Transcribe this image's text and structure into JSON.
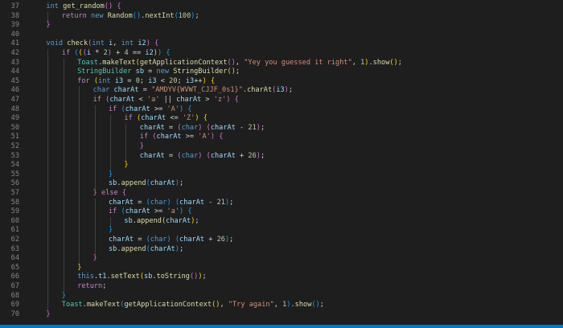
{
  "colors": {
    "background": "#1e1e1e",
    "line_number": "#858585",
    "keyword_control": "#c586c0",
    "keyword": "#569cd6",
    "type": "#4ec9b0",
    "function": "#dcdcaa",
    "variable": "#9cdcfe",
    "number": "#b5cea8",
    "string": "#ce9178",
    "plain": "#d4d4d4",
    "bracket_1": "#ffd700",
    "bracket_2": "#da70d6",
    "bracket_3": "#179fff",
    "status_bar": "#007acc"
  },
  "lines": [
    {
      "num": "37",
      "indent": 1,
      "tokens": [
        [
          "int",
          "keyword"
        ],
        [
          " ",
          "plain"
        ],
        [
          "get_random",
          "function"
        ],
        [
          "()",
          "bracket_2"
        ],
        [
          " ",
          "plain"
        ],
        [
          "{",
          "bracket_2"
        ]
      ]
    },
    {
      "num": "38",
      "indent": 2,
      "tokens": [
        [
          "return",
          "keyword_control"
        ],
        [
          " ",
          "plain"
        ],
        [
          "new",
          "keyword"
        ],
        [
          " ",
          "plain"
        ],
        [
          "Random",
          "function"
        ],
        [
          "()",
          "bracket_3"
        ],
        [
          ".",
          "plain"
        ],
        [
          "nextInt",
          "function"
        ],
        [
          "(",
          "bracket_3"
        ],
        [
          "100",
          "number"
        ],
        [
          ")",
          "bracket_3"
        ],
        [
          ";",
          "plain"
        ]
      ]
    },
    {
      "num": "39",
      "indent": 1,
      "tokens": [
        [
          "}",
          "bracket_2"
        ]
      ]
    },
    {
      "num": "40",
      "indent": 0,
      "tokens": []
    },
    {
      "num": "41",
      "indent": 1,
      "tokens": [
        [
          "void",
          "keyword"
        ],
        [
          " ",
          "plain"
        ],
        [
          "check",
          "function"
        ],
        [
          "(",
          "bracket_2"
        ],
        [
          "int",
          "keyword"
        ],
        [
          " ",
          "plain"
        ],
        [
          "i",
          "variable"
        ],
        [
          ", ",
          "plain"
        ],
        [
          "int",
          "keyword"
        ],
        [
          " ",
          "plain"
        ],
        [
          "i2",
          "variable"
        ],
        [
          ")",
          "bracket_2"
        ],
        [
          " ",
          "plain"
        ],
        [
          "{",
          "bracket_2"
        ]
      ]
    },
    {
      "num": "42",
      "indent": 2,
      "tokens": [
        [
          "if",
          "keyword_control"
        ],
        [
          " ",
          "plain"
        ],
        [
          "(",
          "bracket_3"
        ],
        [
          "(",
          "bracket_1"
        ],
        [
          "(",
          "bracket_2"
        ],
        [
          "i",
          "variable"
        ],
        [
          " * ",
          "plain"
        ],
        [
          "2",
          "number"
        ],
        [
          ")",
          "bracket_2"
        ],
        [
          " + ",
          "plain"
        ],
        [
          "4",
          "number"
        ],
        [
          " == ",
          "plain"
        ],
        [
          "i2",
          "variable"
        ],
        [
          ")",
          "bracket_1"
        ],
        [
          ")",
          "bracket_3"
        ],
        [
          " ",
          "plain"
        ],
        [
          "{",
          "bracket_3"
        ]
      ]
    },
    {
      "num": "43",
      "indent": 3,
      "tokens": [
        [
          "Toast",
          "type"
        ],
        [
          ".",
          "plain"
        ],
        [
          "makeText",
          "function"
        ],
        [
          "(",
          "bracket_1"
        ],
        [
          "getApplicationContext",
          "function"
        ],
        [
          "()",
          "bracket_2"
        ],
        [
          ", ",
          "plain"
        ],
        [
          "\"Yey you guessed it right\"",
          "string"
        ],
        [
          ", ",
          "plain"
        ],
        [
          "1",
          "number"
        ],
        [
          ")",
          "bracket_1"
        ],
        [
          ".",
          "plain"
        ],
        [
          "show",
          "function"
        ],
        [
          "()",
          "bracket_1"
        ],
        [
          ";",
          "plain"
        ]
      ]
    },
    {
      "num": "44",
      "indent": 3,
      "tokens": [
        [
          "StringBuilder",
          "type"
        ],
        [
          " ",
          "plain"
        ],
        [
          "sb",
          "variable"
        ],
        [
          " = ",
          "plain"
        ],
        [
          "new",
          "keyword"
        ],
        [
          " ",
          "plain"
        ],
        [
          "StringBuilder",
          "function"
        ],
        [
          "()",
          "bracket_1"
        ],
        [
          ";",
          "plain"
        ]
      ]
    },
    {
      "num": "45",
      "indent": 3,
      "tokens": [
        [
          "for",
          "keyword_control"
        ],
        [
          " ",
          "plain"
        ],
        [
          "(",
          "bracket_1"
        ],
        [
          "int",
          "keyword"
        ],
        [
          " ",
          "plain"
        ],
        [
          "i3",
          "variable"
        ],
        [
          " = ",
          "plain"
        ],
        [
          "0",
          "number"
        ],
        [
          "; ",
          "plain"
        ],
        [
          "i3",
          "variable"
        ],
        [
          " < ",
          "plain"
        ],
        [
          "20",
          "number"
        ],
        [
          "; ",
          "plain"
        ],
        [
          "i3",
          "variable"
        ],
        [
          "++",
          "plain"
        ],
        [
          ")",
          "bracket_1"
        ],
        [
          " ",
          "plain"
        ],
        [
          "{",
          "bracket_1"
        ]
      ]
    },
    {
      "num": "46",
      "indent": 4,
      "tokens": [
        [
          "char",
          "keyword"
        ],
        [
          " ",
          "plain"
        ],
        [
          "charAt",
          "variable"
        ],
        [
          " = ",
          "plain"
        ],
        [
          "\"AMDYV{WVWT_CJJF_0s1}\"",
          "string"
        ],
        [
          ".",
          "plain"
        ],
        [
          "charAt",
          "function"
        ],
        [
          "(",
          "bracket_2"
        ],
        [
          "i3",
          "variable"
        ],
        [
          ")",
          "bracket_2"
        ],
        [
          ";",
          "plain"
        ]
      ]
    },
    {
      "num": "47",
      "indent": 4,
      "tokens": [
        [
          "if",
          "keyword_control"
        ],
        [
          " ",
          "plain"
        ],
        [
          "(",
          "bracket_2"
        ],
        [
          "charAt",
          "variable"
        ],
        [
          " < ",
          "plain"
        ],
        [
          "'a'",
          "string"
        ],
        [
          " || ",
          "plain"
        ],
        [
          "charAt",
          "variable"
        ],
        [
          " > ",
          "plain"
        ],
        [
          "'z'",
          "string"
        ],
        [
          ")",
          "bracket_2"
        ],
        [
          " ",
          "plain"
        ],
        [
          "{",
          "bracket_2"
        ]
      ]
    },
    {
      "num": "48",
      "indent": 5,
      "tokens": [
        [
          "if",
          "keyword_control"
        ],
        [
          " ",
          "plain"
        ],
        [
          "(",
          "bracket_3"
        ],
        [
          "charAt",
          "variable"
        ],
        [
          " >= ",
          "plain"
        ],
        [
          "'A'",
          "string"
        ],
        [
          ")",
          "bracket_3"
        ],
        [
          " ",
          "plain"
        ],
        [
          "{",
          "bracket_3"
        ]
      ]
    },
    {
      "num": "49",
      "indent": 6,
      "tokens": [
        [
          "if",
          "keyword_control"
        ],
        [
          " ",
          "plain"
        ],
        [
          "(",
          "bracket_1"
        ],
        [
          "charAt",
          "variable"
        ],
        [
          " <= ",
          "plain"
        ],
        [
          "'Z'",
          "string"
        ],
        [
          ")",
          "bracket_1"
        ],
        [
          " ",
          "plain"
        ],
        [
          "{",
          "bracket_1"
        ]
      ]
    },
    {
      "num": "50",
      "indent": 7,
      "tokens": [
        [
          "charAt",
          "variable"
        ],
        [
          " = ",
          "plain"
        ],
        [
          "(",
          "bracket_2"
        ],
        [
          "char",
          "keyword"
        ],
        [
          ")",
          "bracket_2"
        ],
        [
          " ",
          "plain"
        ],
        [
          "(",
          "bracket_2"
        ],
        [
          "charAt",
          "variable"
        ],
        [
          " - ",
          "plain"
        ],
        [
          "21",
          "number"
        ],
        [
          ")",
          "bracket_2"
        ],
        [
          ";",
          "plain"
        ]
      ]
    },
    {
      "num": "51",
      "indent": 7,
      "tokens": [
        [
          "if",
          "keyword_control"
        ],
        [
          " ",
          "plain"
        ],
        [
          "(",
          "bracket_2"
        ],
        [
          "charAt",
          "variable"
        ],
        [
          " >= ",
          "plain"
        ],
        [
          "'A'",
          "string"
        ],
        [
          ")",
          "bracket_2"
        ],
        [
          " ",
          "plain"
        ],
        [
          "{",
          "bracket_2"
        ]
      ]
    },
    {
      "num": "52",
      "indent": 7,
      "tokens": [
        [
          "}",
          "bracket_2"
        ]
      ]
    },
    {
      "num": "53",
      "indent": 7,
      "tokens": [
        [
          "charAt",
          "variable"
        ],
        [
          " = ",
          "plain"
        ],
        [
          "(",
          "bracket_2"
        ],
        [
          "char",
          "keyword"
        ],
        [
          ")",
          "bracket_2"
        ],
        [
          " ",
          "plain"
        ],
        [
          "(",
          "bracket_2"
        ],
        [
          "charAt",
          "variable"
        ],
        [
          " + ",
          "plain"
        ],
        [
          "26",
          "number"
        ],
        [
          ")",
          "bracket_2"
        ],
        [
          ";",
          "plain"
        ]
      ]
    },
    {
      "num": "54",
      "indent": 6,
      "tokens": [
        [
          "}",
          "bracket_1"
        ]
      ]
    },
    {
      "num": "55",
      "indent": 5,
      "tokens": [
        [
          "}",
          "bracket_3"
        ]
      ]
    },
    {
      "num": "56",
      "indent": 5,
      "tokens": [
        [
          "sb",
          "variable"
        ],
        [
          ".",
          "plain"
        ],
        [
          "append",
          "function"
        ],
        [
          "(",
          "bracket_3"
        ],
        [
          "charAt",
          "variable"
        ],
        [
          ")",
          "bracket_3"
        ],
        [
          ";",
          "plain"
        ]
      ]
    },
    {
      "num": "57",
      "indent": 4,
      "tokens": [
        [
          "}",
          "bracket_2"
        ],
        [
          " ",
          "plain"
        ],
        [
          "else",
          "keyword_control"
        ],
        [
          " ",
          "plain"
        ],
        [
          "{",
          "bracket_2"
        ]
      ]
    },
    {
      "num": "58",
      "indent": 5,
      "tokens": [
        [
          "charAt",
          "variable"
        ],
        [
          " = ",
          "plain"
        ],
        [
          "(",
          "bracket_3"
        ],
        [
          "char",
          "keyword"
        ],
        [
          ")",
          "bracket_3"
        ],
        [
          " ",
          "plain"
        ],
        [
          "(",
          "bracket_3"
        ],
        [
          "charAt",
          "variable"
        ],
        [
          " - ",
          "plain"
        ],
        [
          "21",
          "number"
        ],
        [
          ")",
          "bracket_3"
        ],
        [
          ";",
          "plain"
        ]
      ]
    },
    {
      "num": "59",
      "indent": 5,
      "tokens": [
        [
          "if",
          "keyword_control"
        ],
        [
          " ",
          "plain"
        ],
        [
          "(",
          "bracket_3"
        ],
        [
          "charAt",
          "variable"
        ],
        [
          " >= ",
          "plain"
        ],
        [
          "'a'",
          "string"
        ],
        [
          ")",
          "bracket_3"
        ],
        [
          " ",
          "plain"
        ],
        [
          "{",
          "bracket_3"
        ]
      ]
    },
    {
      "num": "60",
      "indent": 6,
      "tokens": [
        [
          "sb",
          "variable"
        ],
        [
          ".",
          "plain"
        ],
        [
          "append",
          "function"
        ],
        [
          "(",
          "bracket_1"
        ],
        [
          "charAt",
          "variable"
        ],
        [
          ")",
          "bracket_1"
        ],
        [
          ";",
          "plain"
        ]
      ]
    },
    {
      "num": "61",
      "indent": 5,
      "tokens": [
        [
          "}",
          "bracket_3"
        ]
      ]
    },
    {
      "num": "62",
      "indent": 5,
      "tokens": [
        [
          "charAt",
          "variable"
        ],
        [
          " = ",
          "plain"
        ],
        [
          "(",
          "bracket_3"
        ],
        [
          "char",
          "keyword"
        ],
        [
          ")",
          "bracket_3"
        ],
        [
          " ",
          "plain"
        ],
        [
          "(",
          "bracket_3"
        ],
        [
          "charAt",
          "variable"
        ],
        [
          " + ",
          "plain"
        ],
        [
          "26",
          "number"
        ],
        [
          ")",
          "bracket_3"
        ],
        [
          ";",
          "plain"
        ]
      ]
    },
    {
      "num": "63",
      "indent": 5,
      "tokens": [
        [
          "sb",
          "variable"
        ],
        [
          ".",
          "plain"
        ],
        [
          "append",
          "function"
        ],
        [
          "(",
          "bracket_3"
        ],
        [
          "charAt",
          "variable"
        ],
        [
          ")",
          "bracket_3"
        ],
        [
          ";",
          "plain"
        ]
      ]
    },
    {
      "num": "64",
      "indent": 4,
      "tokens": [
        [
          "}",
          "bracket_2"
        ]
      ]
    },
    {
      "num": "65",
      "indent": 3,
      "tokens": [
        [
          "}",
          "bracket_1"
        ]
      ]
    },
    {
      "num": "66",
      "indent": 3,
      "tokens": [
        [
          "this",
          "keyword"
        ],
        [
          ".",
          "plain"
        ],
        [
          "t1",
          "variable"
        ],
        [
          ".",
          "plain"
        ],
        [
          "setText",
          "function"
        ],
        [
          "(",
          "bracket_1"
        ],
        [
          "sb",
          "variable"
        ],
        [
          ".",
          "plain"
        ],
        [
          "toString",
          "function"
        ],
        [
          "()",
          "bracket_2"
        ],
        [
          ")",
          "bracket_1"
        ],
        [
          ";",
          "plain"
        ]
      ]
    },
    {
      "num": "67",
      "indent": 3,
      "tokens": [
        [
          "return",
          "keyword_control"
        ],
        [
          ";",
          "plain"
        ]
      ]
    },
    {
      "num": "68",
      "indent": 2,
      "tokens": [
        [
          "}",
          "bracket_3"
        ]
      ]
    },
    {
      "num": "69",
      "indent": 2,
      "tokens": [
        [
          "Toast",
          "type"
        ],
        [
          ".",
          "plain"
        ],
        [
          "makeText",
          "function"
        ],
        [
          "(",
          "bracket_3"
        ],
        [
          "getApplicationContext",
          "function"
        ],
        [
          "()",
          "bracket_1"
        ],
        [
          ", ",
          "plain"
        ],
        [
          "\"Try again\"",
          "string"
        ],
        [
          ", ",
          "plain"
        ],
        [
          "1",
          "number"
        ],
        [
          ")",
          "bracket_3"
        ],
        [
          ".",
          "plain"
        ],
        [
          "show",
          "function"
        ],
        [
          "()",
          "bracket_3"
        ],
        [
          ";",
          "plain"
        ]
      ]
    },
    {
      "num": "70",
      "indent": 1,
      "tokens": [
        [
          "}",
          "bracket_2"
        ]
      ]
    }
  ]
}
